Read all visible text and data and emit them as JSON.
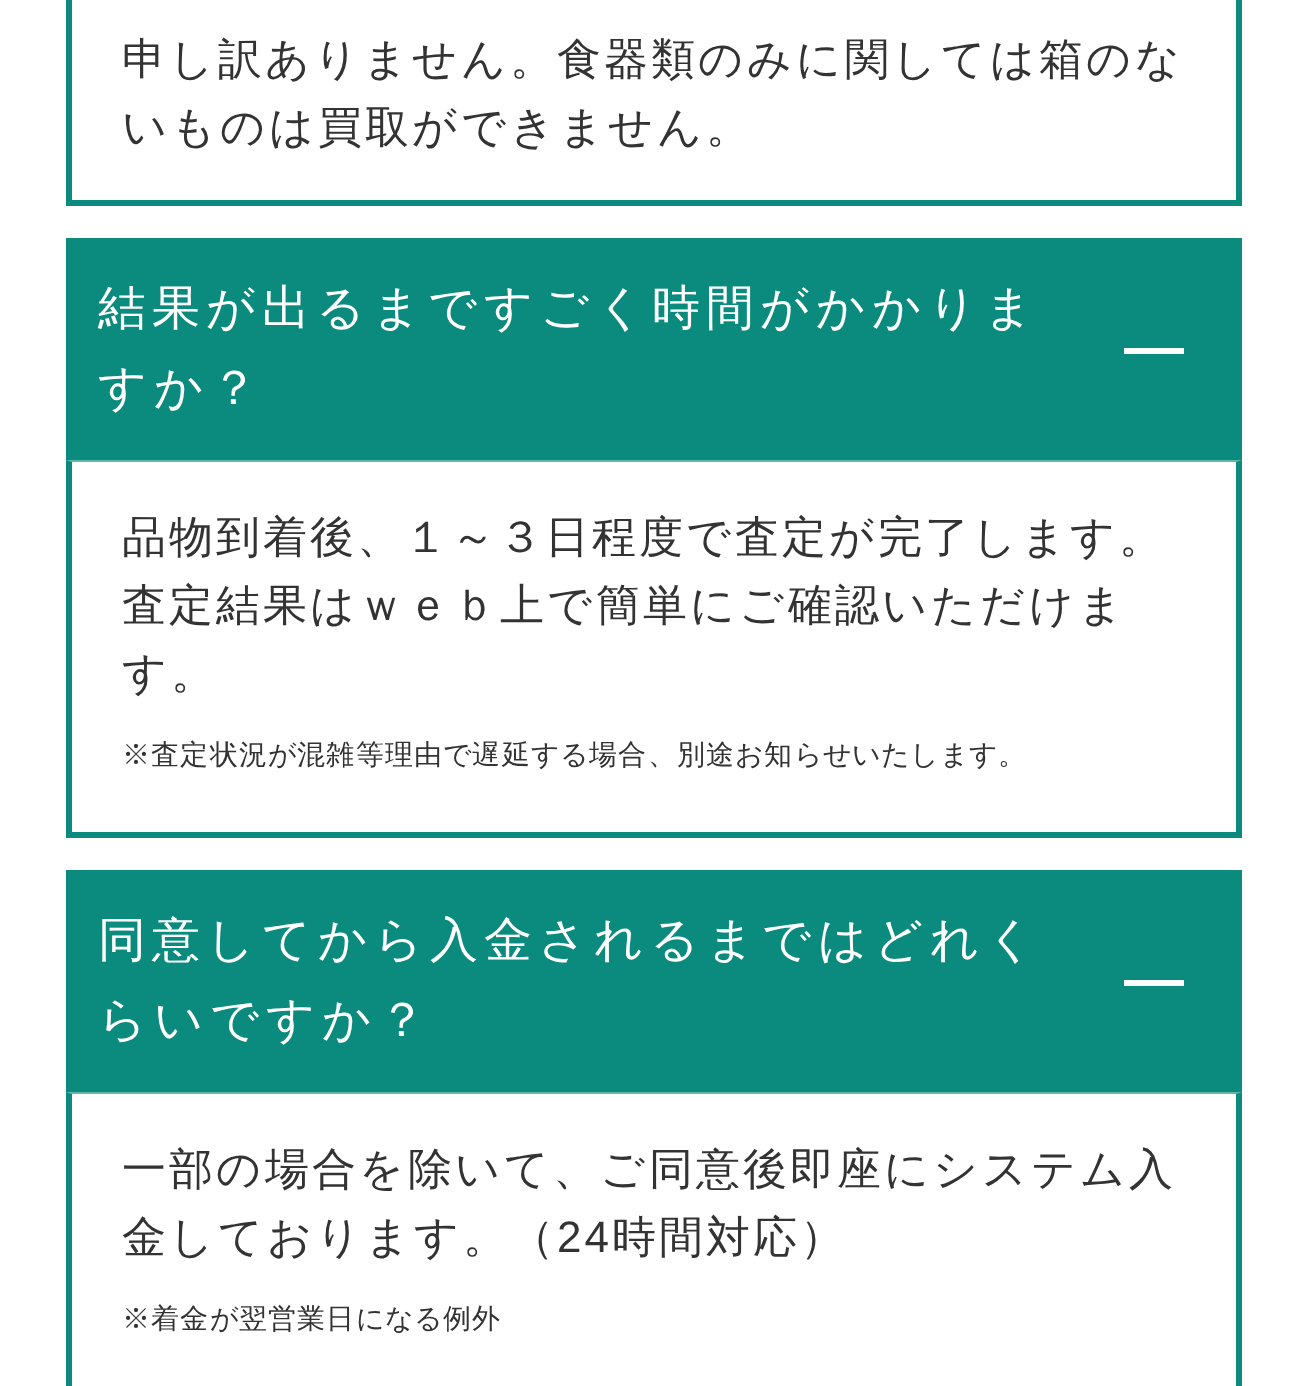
{
  "items": [
    {
      "expanded": true,
      "answer": "申し訳ありません。食器類のみに関しては箱のないものは買取ができません。"
    },
    {
      "question": "結果が出るまですごく時間がかかりますか？",
      "expanded": true,
      "answer": "品物到着後、１～３日程度で査定が完了します。査定結果はｗｅｂ上で簡単にご確認いただけます。",
      "notes": [
        "※査定状況が混雑等理由で遅延する場合、別途お知らせいたします。"
      ]
    },
    {
      "question": "同意してから入金されるまではどれくらいですか？",
      "expanded": true,
      "answer": "一部の場合を除いて、ご同意後即座にシステム入金しております。（24時間対応）",
      "notes": [
        "※着金が翌営業日になる例外"
      ]
    }
  ]
}
